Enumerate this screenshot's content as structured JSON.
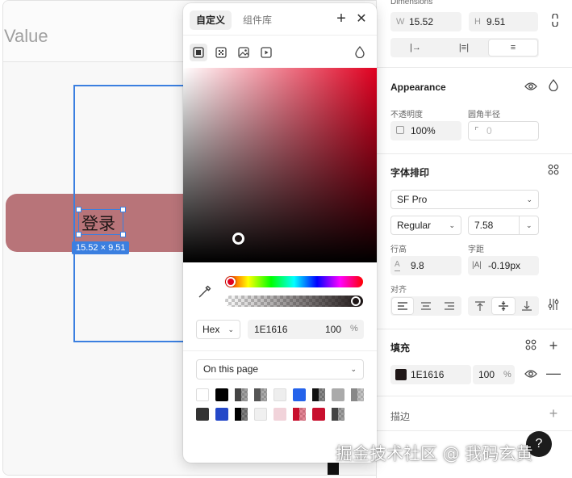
{
  "canvas": {
    "frame_title": "Value",
    "text_layer": "登录",
    "size_badge": "15.52 × 9.51",
    "pill_color": "#b87479",
    "selection_color": "#3b7fe0"
  },
  "picker": {
    "tabs": [
      "自定义",
      "组件库"
    ],
    "add_icon": "plus-icon",
    "close_icon": "close-icon",
    "fill_types": [
      "solid-fill-icon",
      "gradient-fill-icon",
      "image-fill-icon",
      "video-fill-icon"
    ],
    "blend_icon": "drop-icon",
    "hue_color": "#e00020",
    "format": "Hex",
    "hex": "1E1616",
    "alpha": "100",
    "pct": "%",
    "library_select": "On this page",
    "swatches": [
      {
        "color": "#ffffff",
        "type": "solid"
      },
      {
        "color": "#000000",
        "type": "solid"
      },
      {
        "color": "#444444",
        "type": "half"
      },
      {
        "color": "#555555",
        "type": "half"
      },
      {
        "color": "#eeeeee",
        "type": "solid"
      },
      {
        "color": "#2563eb",
        "type": "solid"
      },
      {
        "color": "#111111",
        "type": "half"
      },
      {
        "color": "#aaaaaa",
        "type": "solid"
      },
      {
        "color": "#888888",
        "type": "half"
      },
      {
        "color": "#333333",
        "type": "solid"
      },
      {
        "color": "#2448c8",
        "type": "solid"
      },
      {
        "color": "#000000",
        "type": "half"
      },
      {
        "color": "#f0f0f0",
        "type": "solid"
      },
      {
        "color": "#f1d3da",
        "type": "solid"
      },
      {
        "color": "#c8102e",
        "type": "half"
      },
      {
        "color": "#c8102e",
        "type": "solid"
      },
      {
        "color": "#444444",
        "type": "half"
      }
    ]
  },
  "props": {
    "dimensions": {
      "title": "Dimensions",
      "w_label": "W",
      "w": "15.52",
      "h_label": "H",
      "h": "9.51",
      "resize_opts": [
        "|→",
        "|≡|",
        "≡"
      ]
    },
    "appearance": {
      "title": "Appearance",
      "opacity_label": "不透明度",
      "opacity": "100%",
      "radius_label": "圆角半径",
      "radius": "0"
    },
    "typography": {
      "title": "字体排印",
      "font": "SF Pro",
      "weight": "Regular",
      "size": "7.58",
      "line_height_label": "行高",
      "line_height": "9.8",
      "letter_spacing_label": "字距",
      "letter_spacing": "-0.19px",
      "align_label": "对齐"
    },
    "fill": {
      "title": "填充",
      "hex": "1E1616",
      "alpha": "100",
      "pct": "%",
      "color": "#1e1616"
    },
    "stroke": {
      "title": "描边"
    }
  },
  "help": "?",
  "watermark": "掘金技术社区 @ 我码玄黄"
}
